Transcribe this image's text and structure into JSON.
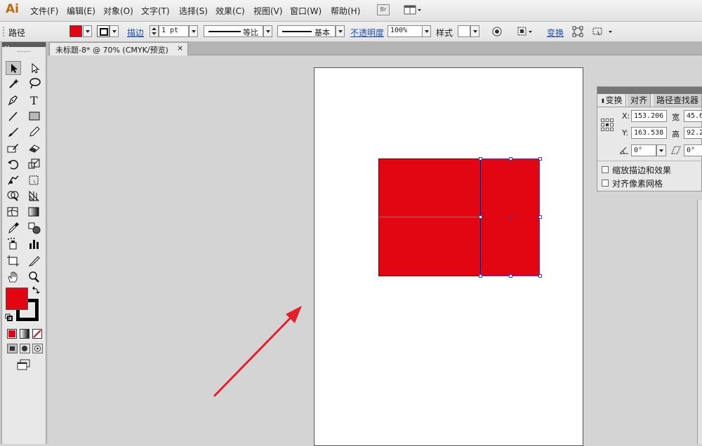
{
  "app": {
    "logo": "Ai"
  },
  "menu": [
    "文件(F)",
    "编辑(E)",
    "对象(O)",
    "文字(T)",
    "选择(S)",
    "效果(C)",
    "视图(V)",
    "窗口(W)",
    "帮助(H)"
  ],
  "bridge_button": "Br",
  "control_bar": {
    "object_type": "路径",
    "fill_color": "#e20613",
    "stroke_label": "描边",
    "stroke_weight": "1 pt",
    "stroke_profile_label": "等比",
    "brush_label": "基本",
    "opacity_label": "不透明度",
    "opacity_value": "100%",
    "style_label": "样式",
    "transform_label": "变换"
  },
  "document_tab": {
    "title": "未标题-8* @ 70% (CMYK/预览)",
    "close": "×"
  },
  "toolbox": {
    "fill_color": "#e20613",
    "stroke_color": "#000000",
    "tools": [
      "selection-tool-icon",
      "direct-selection-tool-icon",
      "magic-wand-tool-icon",
      "lasso-tool-icon",
      "pen-tool-icon",
      "type-tool-icon",
      "line-tool-icon",
      "rectangle-tool-icon",
      "paintbrush-tool-icon",
      "pencil-tool-icon",
      "blob-brush-tool-icon",
      "eraser-tool-icon",
      "rotate-tool-icon",
      "scale-tool-icon",
      "warp-tool-icon",
      "free-transform-tool-icon",
      "shape-builder-tool-icon",
      "perspective-grid-tool-icon",
      "mesh-tool-icon",
      "gradient-tool-icon",
      "eyedropper-tool-icon",
      "blend-tool-icon",
      "symbol-sprayer-tool-icon",
      "column-graph-tool-icon",
      "artboard-tool-icon",
      "slice-tool-icon",
      "hand-tool-icon",
      "zoom-tool-icon"
    ]
  },
  "canvas": {
    "shape_color": "#e20613",
    "arrow_color": "#e3202a"
  },
  "panel": {
    "tabs": [
      "变换",
      "对齐",
      "路径查找器"
    ],
    "x_label": "X:",
    "x_value": "153.206",
    "y_label": "Y:",
    "y_value": "163.538",
    "w_label": "宽",
    "w_value": "45.6",
    "h_label": "高",
    "h_value": "92.2",
    "angle_value": "0°",
    "shear_value": "0°",
    "checkbox_scale_strokes": "缩放描边和效果",
    "checkbox_align_pixel": "对齐像素网格"
  }
}
